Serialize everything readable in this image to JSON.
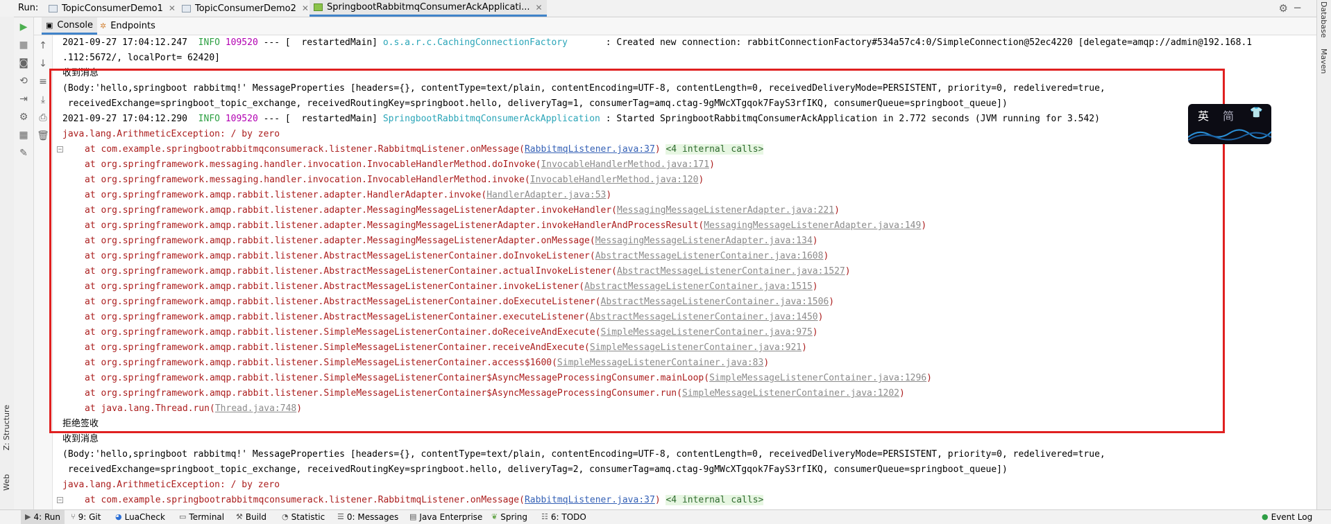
{
  "run": {
    "label": "Run:",
    "tabs": [
      {
        "label": "TopicConsumerDemo1"
      },
      {
        "label": "TopicConsumerDemo2"
      },
      {
        "label": "SpringbootRabbitmqConsumerAckApplicati..."
      }
    ]
  },
  "subtabs": {
    "console": "Console",
    "endpoints": "Endpoints"
  },
  "right_tools": {
    "database": "Database",
    "maven": "Maven"
  },
  "left_tools": {
    "structure": "Z: Structure",
    "web": "Web"
  },
  "ime": {
    "char1": "英",
    "char2": "简"
  },
  "log": {
    "l1": {
      "ts": "2021-09-27 17:04:12.247",
      "level": "INFO",
      "pid": "109520",
      "sep": "---",
      "thread": "[  restartedMain]",
      "logger": "o.s.a.r.c.CachingConnectionFactory",
      "msg": ": Created new connection: rabbitConnectionFactory#534a57c4:0/SimpleConnection@52ec4220 [delegate=amqp://admin@192.168.1"
    },
    "l1b": ".112:5672/, localPort= 62420]",
    "recv1": "收到消息",
    "body1a": "(Body:'hello,springboot rabbitmq!' MessageProperties [headers={}, contentType=text/plain, contentEncoding=UTF-8, contentLength=0, receivedDeliveryMode=PERSISTENT, priority=0, redelivered=true,",
    "body1b": " receivedExchange=springboot_topic_exchange, receivedRoutingKey=springboot.hello, deliveryTag=1, consumerTag=amq.ctag-9gMWcXTgqok7FayS3rfIKQ, consumerQueue=springboot_queue])",
    "l2": {
      "ts": "2021-09-27 17:04:12.290",
      "level": "INFO",
      "pid": "109520",
      "sep": "---",
      "thread": "[  restartedMain]",
      "logger": "SpringbootRabbitmqConsumerAckApplication",
      "msg": ": Started SpringbootRabbitmqConsumerAckApplication in 2.772 seconds (JVM running for 3.542)"
    },
    "exc1": "java.lang.ArithmeticException: / by zero",
    "stack": [
      {
        "at": "at com.example.springbootrabbitmqconsumerack.listener.RabbitmqListener.onMessage(",
        "link": "RabbitmqListener.java:37",
        "end": ")",
        "internal": "<4 internal calls>",
        "linkstyle": "blue"
      },
      {
        "at": "at org.springframework.messaging.handler.invocation.InvocableHandlerMethod.doInvoke(",
        "link": "InvocableHandlerMethod.java:171",
        "end": ")"
      },
      {
        "at": "at org.springframework.messaging.handler.invocation.InvocableHandlerMethod.invoke(",
        "link": "InvocableHandlerMethod.java:120",
        "end": ")"
      },
      {
        "at": "at org.springframework.amqp.rabbit.listener.adapter.HandlerAdapter.invoke(",
        "link": "HandlerAdapter.java:53",
        "end": ")"
      },
      {
        "at": "at org.springframework.amqp.rabbit.listener.adapter.MessagingMessageListenerAdapter.invokeHandler(",
        "link": "MessagingMessageListenerAdapter.java:221",
        "end": ")"
      },
      {
        "at": "at org.springframework.amqp.rabbit.listener.adapter.MessagingMessageListenerAdapter.invokeHandlerAndProcessResult(",
        "link": "MessagingMessageListenerAdapter.java:149",
        "end": ")"
      },
      {
        "at": "at org.springframework.amqp.rabbit.listener.adapter.MessagingMessageListenerAdapter.onMessage(",
        "link": "MessagingMessageListenerAdapter.java:134",
        "end": ")"
      },
      {
        "at": "at org.springframework.amqp.rabbit.listener.AbstractMessageListenerContainer.doInvokeListener(",
        "link": "AbstractMessageListenerContainer.java:1608",
        "end": ")"
      },
      {
        "at": "at org.springframework.amqp.rabbit.listener.AbstractMessageListenerContainer.actualInvokeListener(",
        "link": "AbstractMessageListenerContainer.java:1527",
        "end": ")"
      },
      {
        "at": "at org.springframework.amqp.rabbit.listener.AbstractMessageListenerContainer.invokeListener(",
        "link": "AbstractMessageListenerContainer.java:1515",
        "end": ")"
      },
      {
        "at": "at org.springframework.amqp.rabbit.listener.AbstractMessageListenerContainer.doExecuteListener(",
        "link": "AbstractMessageListenerContainer.java:1506",
        "end": ")"
      },
      {
        "at": "at org.springframework.amqp.rabbit.listener.AbstractMessageListenerContainer.executeListener(",
        "link": "AbstractMessageListenerContainer.java:1450",
        "end": ")"
      },
      {
        "at": "at org.springframework.amqp.rabbit.listener.SimpleMessageListenerContainer.doReceiveAndExecute(",
        "link": "SimpleMessageListenerContainer.java:975",
        "end": ")"
      },
      {
        "at": "at org.springframework.amqp.rabbit.listener.SimpleMessageListenerContainer.receiveAndExecute(",
        "link": "SimpleMessageListenerContainer.java:921",
        "end": ")"
      },
      {
        "at": "at org.springframework.amqp.rabbit.listener.SimpleMessageListenerContainer.access$1600(",
        "link": "SimpleMessageListenerContainer.java:83",
        "end": ")"
      },
      {
        "at": "at org.springframework.amqp.rabbit.listener.SimpleMessageListenerContainer$AsyncMessageProcessingConsumer.mainLoop(",
        "link": "SimpleMessageListenerContainer.java:1296",
        "end": ")"
      },
      {
        "at": "at org.springframework.amqp.rabbit.listener.SimpleMessageListenerContainer$AsyncMessageProcessingConsumer.run(",
        "link": "SimpleMessageListenerContainer.java:1202",
        "end": ")"
      },
      {
        "at": "at java.lang.Thread.run(",
        "link": "Thread.java:748",
        "end": ")"
      }
    ],
    "reject": "拒绝签收",
    "recv2": "收到消息",
    "body2a": "(Body:'hello,springboot rabbitmq!' MessageProperties [headers={}, contentType=text/plain, contentEncoding=UTF-8, contentLength=0, receivedDeliveryMode=PERSISTENT, priority=0, redelivered=true,",
    "body2b": " receivedExchange=springboot_topic_exchange, receivedRoutingKey=springboot.hello, deliveryTag=2, consumerTag=amq.ctag-9gMWcXTgqok7FayS3rfIKQ, consumerQueue=springboot_queue])",
    "exc2": "java.lang.ArithmeticException: / by zero",
    "last": {
      "at": "at com.example.springbootrabbitmqconsumerack.listener.RabbitmqListener.onMessage(",
      "link": "RabbitmqListener.java:37",
      "end": ")",
      "internal": "<4 internal calls>"
    }
  },
  "bottom": {
    "run": "4: Run",
    "git": "9: Git",
    "luacheck": "LuaCheck",
    "terminal": "Terminal",
    "build": "Build",
    "statistic": "Statistic",
    "messages": "0: Messages",
    "java_enterprise": "Java Enterprise",
    "spring": "Spring",
    "todo": "6: TODO",
    "event_log": "Event Log"
  },
  "colors": {
    "info": "#2ea043",
    "pid": "#b200b2",
    "logger": "#2aa5b8",
    "error": "#ab1d1d",
    "link": "#3561b6",
    "highlight": "#e02020",
    "accent": "#4083c9"
  }
}
